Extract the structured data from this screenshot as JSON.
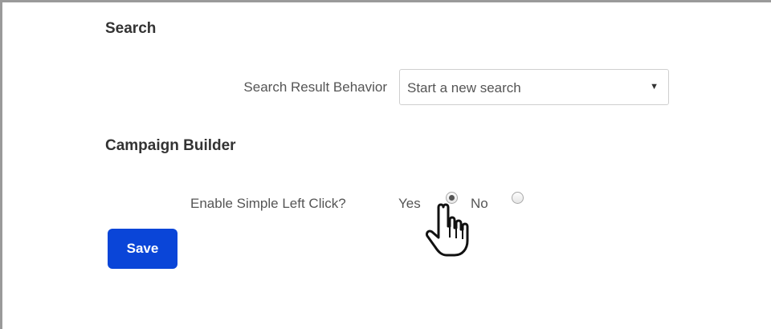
{
  "search": {
    "title": "Search",
    "result_behavior_label": "Search Result Behavior",
    "result_behavior_value": "Start a new search"
  },
  "campaign_builder": {
    "title": "Campaign Builder",
    "simple_left_click_label": "Enable Simple Left Click?",
    "options": [
      {
        "label": "Yes",
        "selected": true
      },
      {
        "label": "No",
        "selected": false
      }
    ]
  },
  "actions": {
    "save_label": "Save"
  },
  "icons": {
    "select_arrow": "chevron-down-icon",
    "cursor": "hand-pointer-icon"
  },
  "colors": {
    "primary_button": "#0a45d8",
    "border": "#9a9a9a"
  }
}
